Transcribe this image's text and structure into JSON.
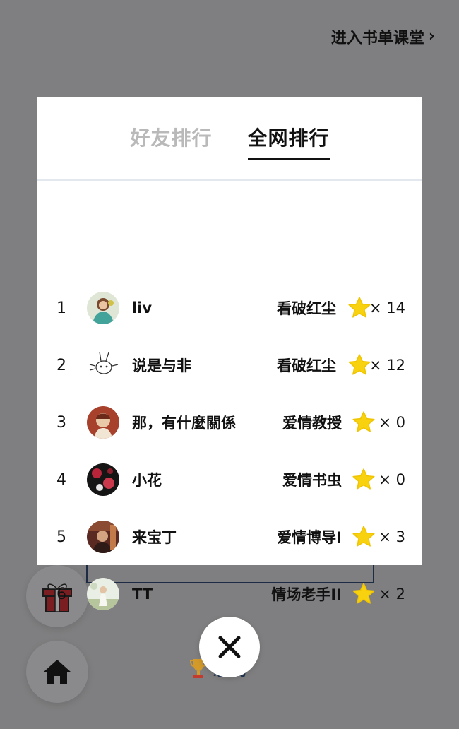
{
  "header": {
    "top_link": "进入书单课堂",
    "chevron": "›"
  },
  "modal": {
    "tabs": [
      {
        "label": "好友排行",
        "active": false
      },
      {
        "label": "全网排行",
        "active": true
      }
    ],
    "rows": [
      {
        "rank": "1",
        "name": "liv",
        "title": "看破红尘",
        "count": "× 14"
      },
      {
        "rank": "2",
        "name": "说是与非",
        "title": "看破红尘",
        "count": "× 12"
      },
      {
        "rank": "3",
        "name": "那，有什麼關係",
        "title": "爱情教授",
        "count": "× 0"
      },
      {
        "rank": "4",
        "name": "小花",
        "title": "爱情书虫",
        "count": "× 0"
      },
      {
        "rank": "5",
        "name": "来宝丁",
        "title": "爱情博导I",
        "count": "× 3"
      },
      {
        "rank": "6",
        "name": "TT",
        "title": "情场老手II",
        "count": "× 2"
      }
    ]
  },
  "footer": {
    "rank_label": "总榜",
    "close_icon": "close-icon",
    "gift_icon": "gift-icon",
    "home_icon": "home-icon"
  },
  "colors": {
    "overlay": "#7f7f81",
    "star": "#f8d20f",
    "accent_text": "#1e3350"
  }
}
